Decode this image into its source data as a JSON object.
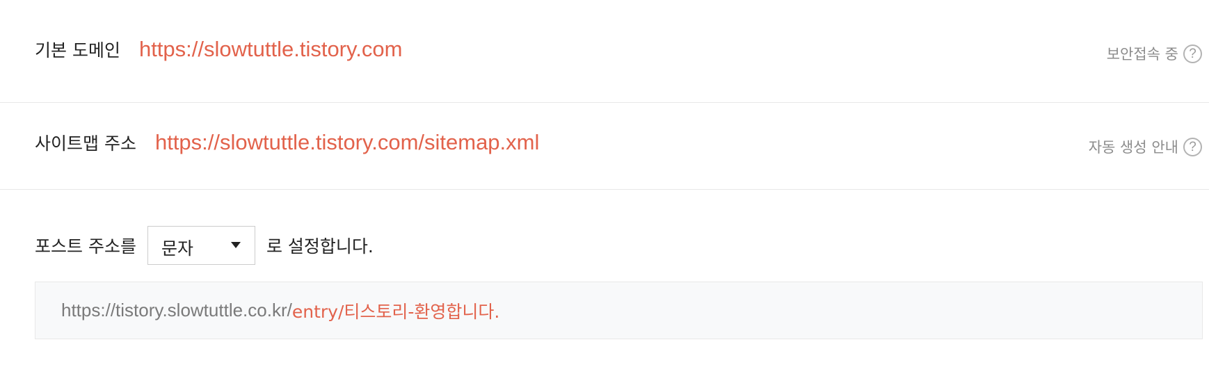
{
  "colors": {
    "accent": "#e2624b",
    "muted_text": "#8c8c8c",
    "divider": "#e8e8e8",
    "preview_bg": "#f8f9fa"
  },
  "domain": {
    "label": "기본 도메인",
    "url": "https://slowtuttle.tistory.com",
    "help_text": "보안접속 중",
    "help_icon": "question-circle-icon",
    "help_glyph": "?"
  },
  "sitemap": {
    "label": "사이트맵 주소",
    "url": "https://slowtuttle.tistory.com/sitemap.xml",
    "help_text": "자동 생성 안내",
    "help_icon": "question-circle-icon",
    "help_glyph": "?"
  },
  "post_address": {
    "prefix": "포스트 주소를",
    "selected_option": "문자",
    "suffix": "로 설정합니다.",
    "preview_base": "https://tistory.slowtuttle.co.kr/",
    "preview_path": "entry/티스토리-환영합니다."
  }
}
